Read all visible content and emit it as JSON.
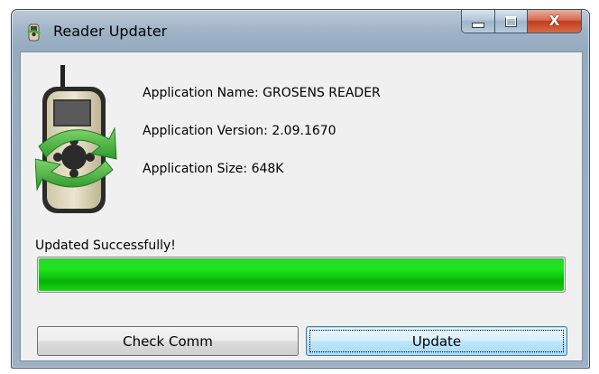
{
  "window": {
    "title": "Reader Updater",
    "close_glyph": "X"
  },
  "info": {
    "name_line": "Application Name: GROSENS READER",
    "version_line": "Application Version: 2.09.1670",
    "size_line": "Application Size: 648K"
  },
  "status": {
    "text": "Updated Successfully!",
    "progress": 1.0
  },
  "buttons": {
    "check_comm": "Check Comm",
    "update": "Update"
  },
  "icons": {
    "title_icon": "reader-device-icon",
    "app_icon": "reader-device-sync-icon"
  },
  "colors": {
    "progress_green": "#0fca0f",
    "close_red": "#c23c1f"
  }
}
